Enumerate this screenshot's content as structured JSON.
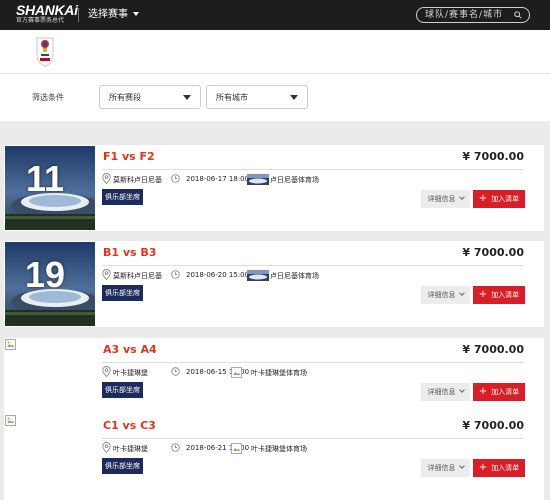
{
  "topbar": {
    "logo": "SHANKAi",
    "logo_sub": "官方赛事票务总代",
    "event_select": "选择赛事",
    "search_placeholder": "球队/赛事名/城市"
  },
  "filters": {
    "label": "筛选条件",
    "stage": "所有赛段",
    "city": "所有城市"
  },
  "matches": [
    {
      "number": "11",
      "teams": "F1 vs F2",
      "price": "¥ 7000.00",
      "city": "莫斯科卢日尼基",
      "datetime": "2018-06-17 18:00",
      "venue": "卢日尼基体育场",
      "badge": "俱乐部坐席",
      "detail": "详细信息",
      "add": "加入清单"
    },
    {
      "number": "19",
      "teams": "B1 vs B3",
      "price": "¥ 7000.00",
      "city": "莫斯科卢日尼基",
      "datetime": "2018-06-20 15:00",
      "venue": "卢日尼基体育场",
      "badge": "俱乐部坐席",
      "detail": "详细信息",
      "add": "加入清单"
    },
    {
      "number": "",
      "teams": "A3 vs A4",
      "price": "¥ 7000.00",
      "city": "叶卡捷琳堡",
      "datetime": "2018-06-15 17:00",
      "venue": "叶卡捷琳堡体育场",
      "badge": "俱乐部坐席",
      "detail": "详细信息",
      "add": "加入清单"
    },
    {
      "number": "",
      "teams": "C1 vs C3",
      "price": "¥ 7000.00",
      "city": "叶卡捷琳堡",
      "datetime": "2018-06-21 17:00",
      "venue": "叶卡捷琳堡体育场",
      "badge": "俱乐部坐席",
      "detail": "详细信息",
      "add": "加入清单"
    }
  ],
  "colors": {
    "accent_red": "#d71f28",
    "team_red": "#e2331c",
    "badge_navy": "#1c2a5c",
    "topbar": "#1d1d1d"
  }
}
